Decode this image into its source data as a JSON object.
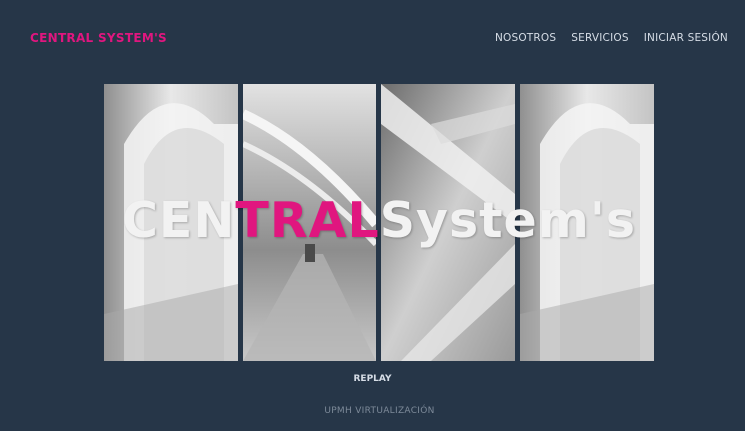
{
  "header": {
    "brand": "CENTRAL SYSTEM'S",
    "nav": [
      "NOSOTROS",
      "SERVICIOS",
      "INICIAR SESIÓN"
    ]
  },
  "hero": {
    "title_part1": "CEN",
    "title_accent": "TRAL",
    "title_part2": "System's",
    "replay_label": "REPLAY"
  },
  "footer": {
    "text": "UPMH VIRTUALIZACIÓN"
  },
  "colors": {
    "background": "#263648",
    "accent": "#e0167f",
    "text": "#d6dde6"
  }
}
